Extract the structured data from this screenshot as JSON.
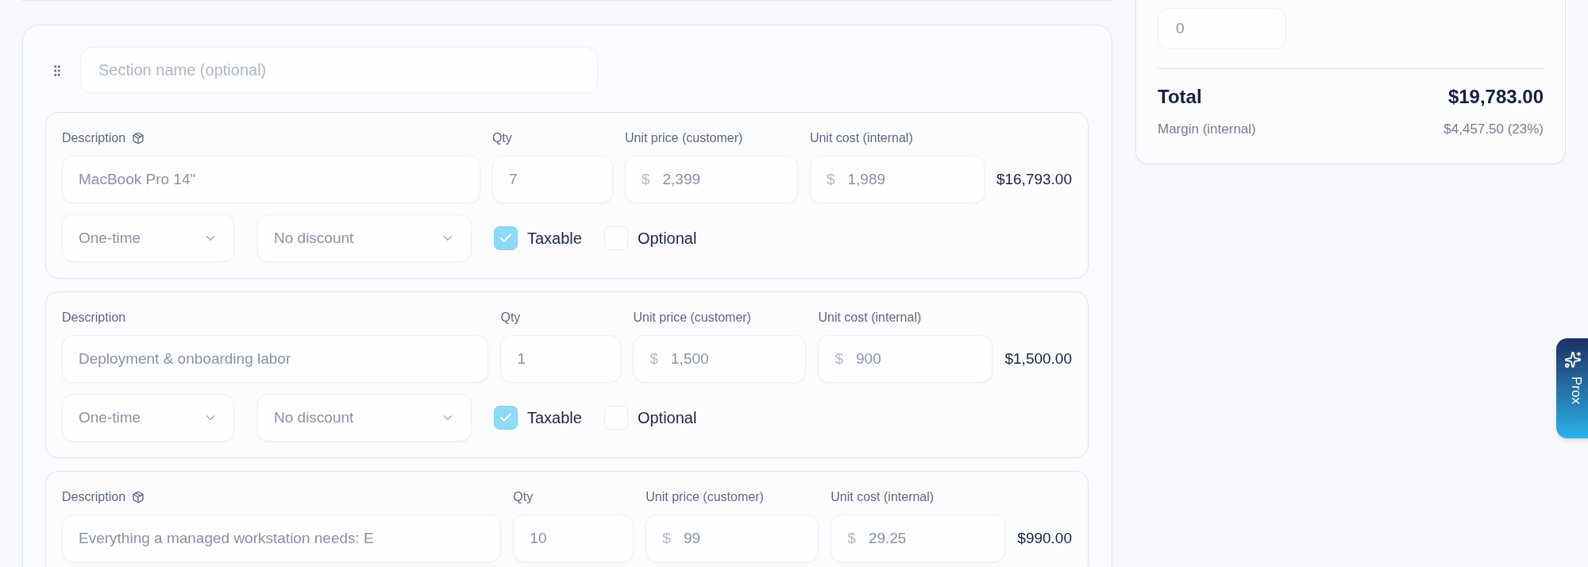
{
  "section": {
    "name_placeholder": "Section name (optional)"
  },
  "items": [
    {
      "description_label": "Description",
      "catalog": true,
      "description": "MacBook Pro 14\"",
      "qty_label": "Qty",
      "qty": "7",
      "price_label": "Unit price (customer)",
      "price_currency": "$",
      "price": "2,399",
      "cost_label": "Unit cost (internal)",
      "cost_currency": "$",
      "cost": "1,989",
      "line_total": "$16,793.00",
      "billing": "One-time",
      "discount": "No discount",
      "options": [
        {
          "label": "Taxable",
          "checked": true
        },
        {
          "label": "Optional",
          "checked": false
        }
      ]
    },
    {
      "description_label": "Description",
      "catalog": false,
      "description": "Deployment & onboarding labor",
      "qty_label": "Qty",
      "qty": "1",
      "price_label": "Unit price (customer)",
      "price_currency": "$",
      "price": "1,500",
      "cost_label": "Unit cost (internal)",
      "cost_currency": "$",
      "cost": "900",
      "line_total": "$1,500.00",
      "billing": "One-time",
      "discount": "No discount",
      "options": [
        {
          "label": "Taxable",
          "checked": true
        },
        {
          "label": "Optional",
          "checked": false
        }
      ]
    },
    {
      "description_label": "Description",
      "catalog": true,
      "description": "Everything a managed workstation needs: E",
      "qty_label": "Qty",
      "qty": "10",
      "price_label": "Unit price (customer)",
      "price_currency": "$",
      "price": "99",
      "cost_label": "Unit cost (internal)",
      "cost_currency": "$",
      "cost": "29.25",
      "line_total": "$990.00"
    }
  ],
  "summary": {
    "input_value": "0",
    "total_label": "Total",
    "total": "$19,783.00",
    "margin_label": "Margin (internal)",
    "margin": "$4,457.50 (23%)"
  },
  "assistant_tab": {
    "label": "Prox"
  }
}
